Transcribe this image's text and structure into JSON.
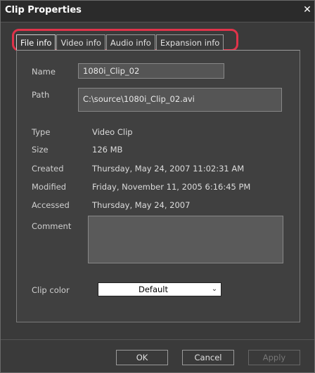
{
  "window": {
    "title": "Clip Properties",
    "close_icon": "close-icon"
  },
  "tabs": [
    {
      "label": "File info",
      "active": true
    },
    {
      "label": "Video info",
      "active": false
    },
    {
      "label": "Audio info",
      "active": false
    },
    {
      "label": "Expansion info",
      "active": false
    }
  ],
  "highlight_color": "#e0334a",
  "file_info": {
    "name_label": "Name",
    "name_value": "1080i_Clip_02",
    "path_label": "Path",
    "path_value": "C:\\source\\1080i_Clip_02.avi",
    "type_label": "Type",
    "type_value": "Video Clip",
    "size_label": "Size",
    "size_value": "126 MB",
    "created_label": "Created",
    "created_value": "Thursday, May 24, 2007 11:02:31 AM",
    "modified_label": "Modified",
    "modified_value": "Friday, November 11, 2005 6:16:45 PM",
    "accessed_label": "Accessed",
    "accessed_value": "Thursday, May 24, 2007",
    "comment_label": "Comment",
    "comment_value": "",
    "clip_color_label": "Clip color",
    "clip_color_value": "Default"
  },
  "buttons": {
    "ok": "OK",
    "cancel": "Cancel",
    "apply": "Apply"
  }
}
